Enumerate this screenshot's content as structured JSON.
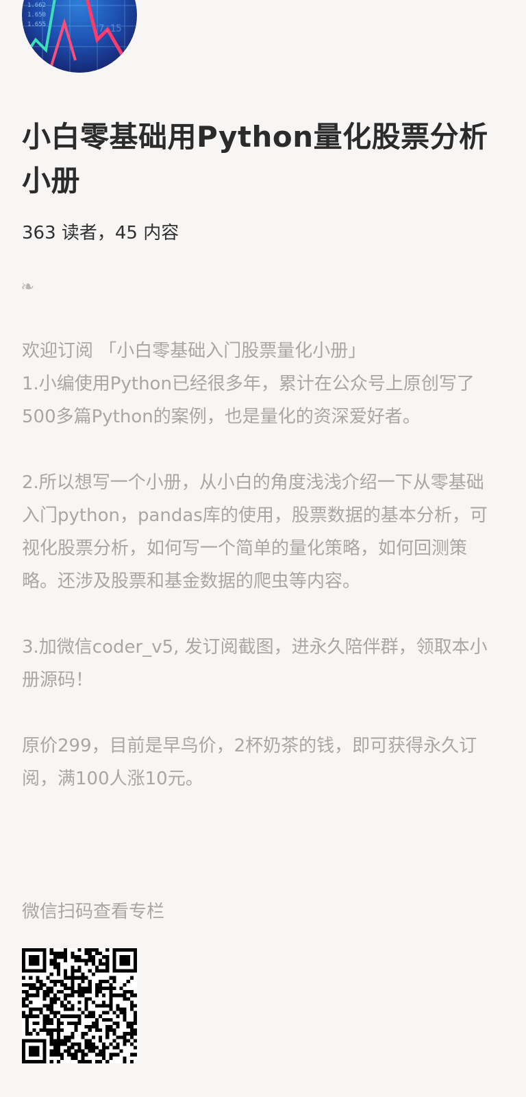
{
  "column": {
    "title": "小白零基础用Python量化股票分析小册",
    "meta": "363 读者，45 内容",
    "fleuron": "❧",
    "description": [
      "欢迎订阅 「小白零基础入门股票量化小册」\n1.小编使用Python已经很多年，累计在公众号上原创写了500多篇Python的案例，也是量化的资深爱好者。",
      "2.所以想写一个小册，从小白的角度浅浅介绍一下从零基础入门python，pandas库的使用，股票数据的基本分析，可视化股票分析，如何写一个简单的量化策略，如何回测策略。还涉及股票和基金数据的爬虫等内容。",
      "3.加微信coder_v5, 发订阅截图，进永久陪伴群，领取本小册源码！",
      "原价299，目前是早鸟价，2杯奶茶的钱，即可获得永久订阅，满100人涨10元。"
    ],
    "scan_label": "微信扫码查看专栏"
  },
  "colors": {
    "background": "#f7f6f5",
    "title": "#2b2b2b",
    "body_text": "#a9a6a3"
  },
  "icons": {
    "cover": "stock-chart-cover-image",
    "fleuron": "fleuron-ornament-icon",
    "qr": "qr-code"
  }
}
